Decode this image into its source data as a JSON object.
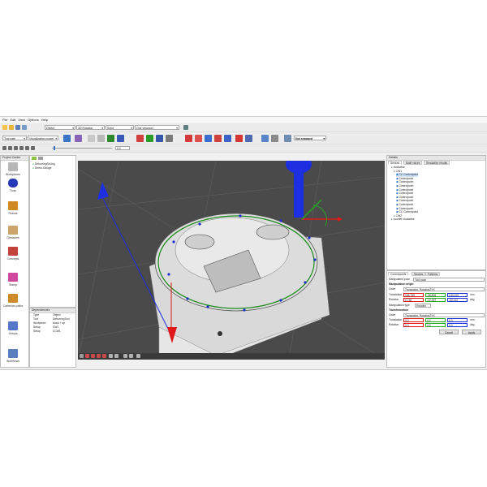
{
  "menu": [
    "File",
    "Edit",
    "View",
    "Options",
    "Help"
  ],
  "toolbar1": {
    "combo_object": "Object",
    "combo_rotation": "3D Rotation",
    "combo_solid": "Solid",
    "combo_viewport": "One viewport"
  },
  "toolbar2": {
    "combo_toolpath": "Tool path",
    "combo_visualization": "Visualization model",
    "snap_label": "Not snapped"
  },
  "toolbar3": {
    "field_value": "0.0"
  },
  "left_nav": {
    "title": "Project Center",
    "items": [
      "Workpieces",
      "Tools",
      "Robots",
      "Obstacles",
      "Concepts",
      "Stamp",
      "Cartesian paths",
      "Setups",
      "Workflows"
    ]
  },
  "project_tree": {
    "items": [
      "DeburringStrUng",
      "Demo-Oktoge"
    ]
  },
  "dependencies": {
    "title": "Dependencies",
    "headers": [
      "Type",
      "Object"
    ],
    "rows": [
      [
        "Tool",
        "DeburringTool"
      ],
      [
        "Workpiece",
        "stock + sp"
      ],
      [
        "Setup",
        "CW1"
      ],
      [
        "Setup",
        "CCW1"
      ]
    ]
  },
  "right_panel": {
    "title": "Details",
    "tabs": [
      "Strokes",
      "Motif voices",
      "Simulation results"
    ],
    "tree": [
      {
        "label": "clockwise",
        "indent": 1
      },
      {
        "label": "CW1",
        "indent": 2
      },
      {
        "label": "CC Controlpoint",
        "indent": 3,
        "selected": true
      },
      {
        "label": "Controlpoint",
        "indent": 3
      },
      {
        "label": "Controlpoint",
        "indent": 3
      },
      {
        "label": "Controlpoint",
        "indent": 3
      },
      {
        "label": "Controlpoint",
        "indent": 3
      },
      {
        "label": "Controlpoint",
        "indent": 3
      },
      {
        "label": "Controlpoint",
        "indent": 3
      },
      {
        "label": "Controlpoint",
        "indent": 3
      },
      {
        "label": "Controlpoint",
        "indent": 3
      },
      {
        "label": "Controlpoint",
        "indent": 3
      },
      {
        "label": "CC Controlpoint",
        "indent": 3
      },
      {
        "label": "CW2",
        "indent": 2
      },
      {
        "label": "counter clockwise",
        "indent": 1
      }
    ]
  },
  "props": {
    "tabs": [
      "Controlpoints",
      "Strokes",
      "Patterns"
    ],
    "manip_pose_label": "Manipulated pose",
    "manip_pose_value": "Tool pose",
    "section1": "Manipulation origin",
    "order_label": "Order",
    "order_value": "Translation, RotationZYX",
    "translation_label": "Translation",
    "translation": [
      "106,759",
      "-38,806",
      "139,209"
    ],
    "unit": "mm",
    "rotation_label": "Rotation",
    "rotation": [
      "0,746",
      "-22,397",
      "-63,410"
    ],
    "unit_deg": "deg",
    "manip_type_label": "Manipulation type",
    "manip_type_value": "Relative",
    "section2": "Transformation",
    "order2_value": "Translation, RotationZYX",
    "translation2": [
      "0,0",
      "0,0",
      "0,0"
    ],
    "rotation2": [
      "0,0",
      "0,0",
      "0,0"
    ],
    "cancel": "Cancel",
    "apply": "Apply"
  },
  "colors": {
    "viewport_bg": "#4a4a4a",
    "accent_blue": "#1133dd",
    "red": "#e01818",
    "green": "#22aa22"
  }
}
